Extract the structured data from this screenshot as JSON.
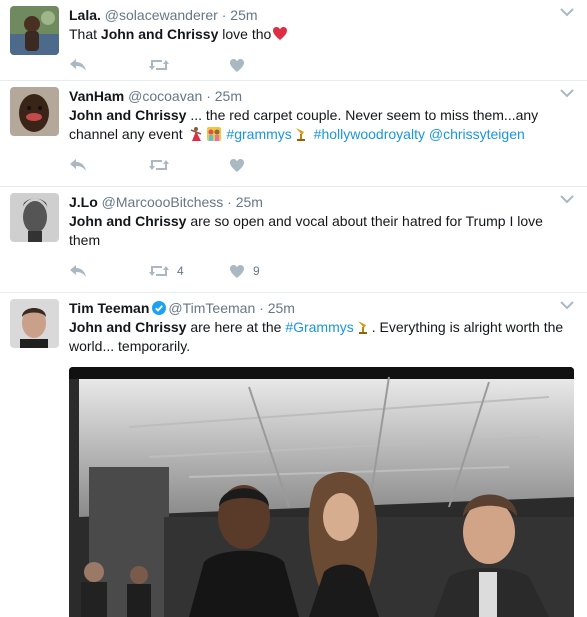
{
  "tweets": [
    {
      "name": "Lala.",
      "handle": "@solacewanderer",
      "time": "25m",
      "text_before": "That ",
      "bold": "John and Chrissy",
      "text_after": " love tho",
      "emoji": "red-heart"
    },
    {
      "name": "VanHam",
      "handle": "@cocoavan",
      "time": "25m",
      "bold": "John and Chrissy",
      "text_after": " ... the red carpet couple. Never seem to miss them...any channel any event ",
      "hashtags": [
        "#grammys",
        "#hollywoodroyalty"
      ],
      "mention": "@chrissyteigen"
    },
    {
      "name": "J.Lo",
      "handle": "@MarcoooBitchess",
      "time": "25m",
      "bold": "John and Chrissy",
      "text_after": " are so open and vocal about their hatred for Trump I love them",
      "retweets": "4",
      "likes": "9"
    },
    {
      "name": "Tim Teeman",
      "handle": "@TimTeeman",
      "time": "25m",
      "bold": "John and Chrissy",
      "text_mid": " are here at the ",
      "hashtag": "#Grammys",
      "text_after": ". Everything is alright worth the world... temporarily."
    }
  ],
  "icons": {
    "reply": "reply-icon",
    "retweet": "retweet-icon",
    "like": "heart-icon",
    "menu": "chevron-down-icon",
    "verified": "verified-badge-icon",
    "trophy": "gramophone-emoji"
  },
  "colors": {
    "link": "#1b95e0",
    "muted": "#657786",
    "icon": "#aab8c2",
    "heart": "#e0245e"
  }
}
